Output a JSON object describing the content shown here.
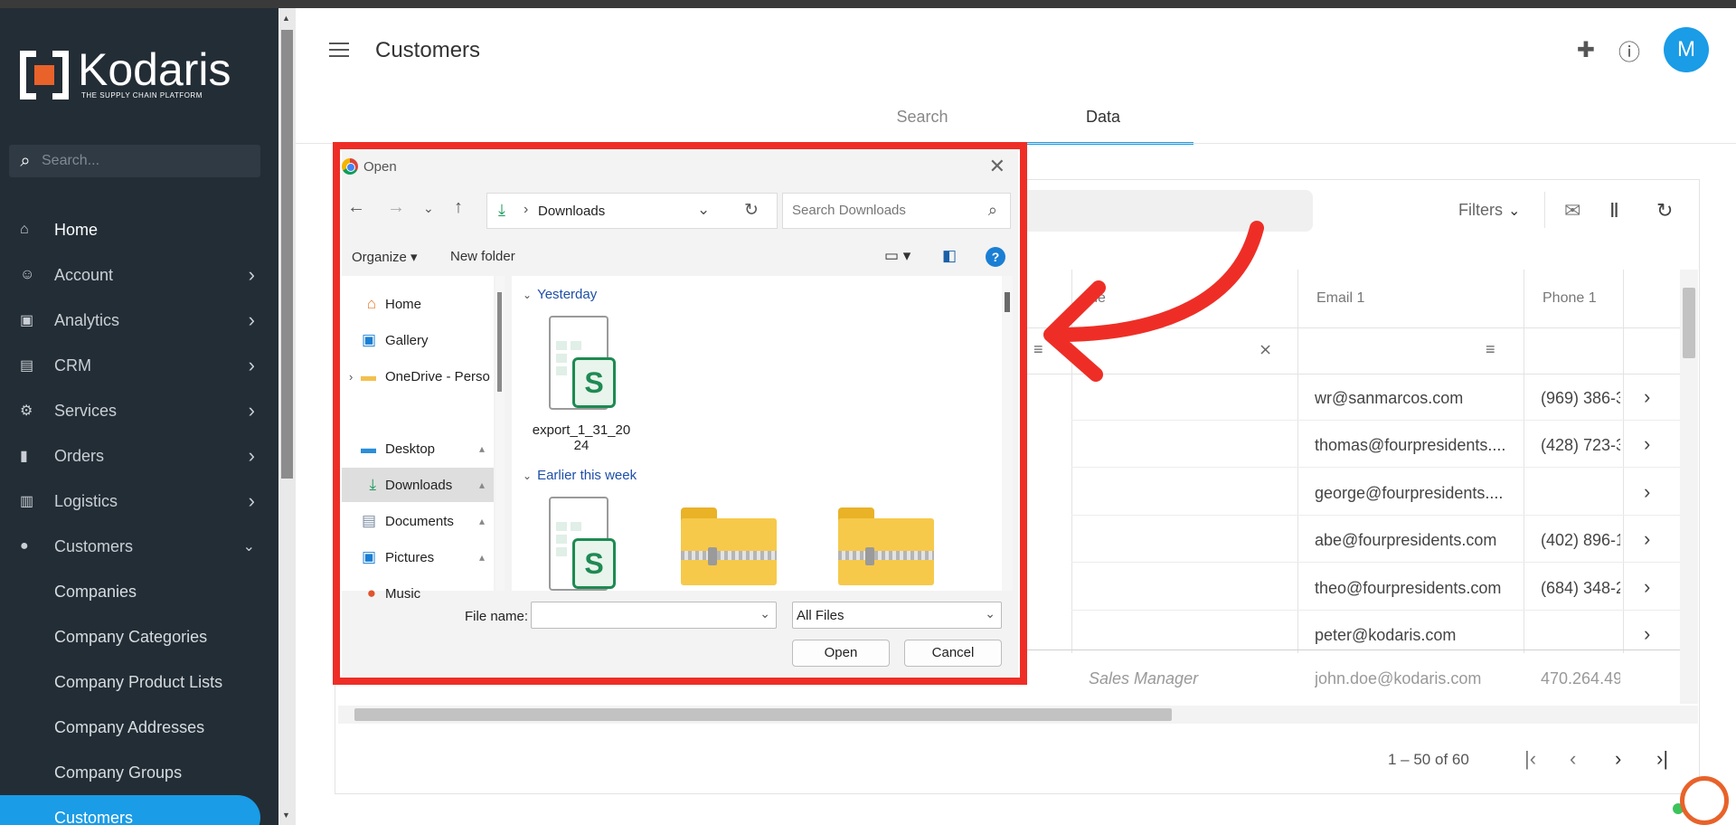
{
  "sidebar": {
    "brand": {
      "name": "Kodaris",
      "tagline": "THE SUPPLY CHAIN PLATFORM"
    },
    "search_placeholder": "Search...",
    "items": [
      {
        "label": "Home",
        "icon": "home-icon"
      },
      {
        "label": "Account",
        "icon": "account-icon"
      },
      {
        "label": "Analytics",
        "icon": "analytics-icon"
      },
      {
        "label": "CRM",
        "icon": "crm-icon"
      },
      {
        "label": "Services",
        "icon": "services-icon"
      },
      {
        "label": "Orders",
        "icon": "truck-icon"
      },
      {
        "label": "Logistics",
        "icon": "logistics-icon"
      },
      {
        "label": "Customers",
        "icon": "people-icon"
      }
    ],
    "sub_items": [
      "Companies",
      "Company Categories",
      "Company Product Lists",
      "Company Addresses",
      "Company Groups",
      "Customers"
    ]
  },
  "header": {
    "title": "Customers",
    "avatar_initial": "M",
    "tabs": [
      "Search",
      "Data"
    ]
  },
  "table": {
    "filters_label": "Filters",
    "columns": [
      "tle",
      "Email 1",
      "Phone 1"
    ],
    "rows": [
      {
        "email": "wr@sanmarcos.com",
        "phone": "(969) 386-3"
      },
      {
        "email": "thomas@fourpresidents....",
        "phone": "(428) 723-3"
      },
      {
        "email": "george@fourpresidents....",
        "phone": ""
      },
      {
        "email": "abe@fourpresidents.com",
        "phone": "(402) 896-1"
      },
      {
        "email": "theo@fourpresidents.com",
        "phone": "(684) 348-2"
      },
      {
        "email": "peter@kodaris.com",
        "phone": ""
      }
    ],
    "last_row": {
      "title": "Sales Manager",
      "email": "john.doe@kodaris.com",
      "phone": "470.264.49"
    },
    "pagination": "1 – 50 of 60"
  },
  "dialog": {
    "title": "Open",
    "address_path": "Downloads",
    "search_placeholder": "Search Downloads",
    "organize_label": "Organize",
    "new_folder_label": "New folder",
    "nav_items": [
      {
        "label": "Home",
        "icon": "home-icon"
      },
      {
        "label": "Gallery",
        "icon": "gallery-icon"
      },
      {
        "label": "OneDrive - Perso",
        "icon": "folder-icon"
      },
      {
        "label": "Desktop",
        "icon": "desktop-icon"
      },
      {
        "label": "Downloads",
        "icon": "download-icon"
      },
      {
        "label": "Documents",
        "icon": "documents-icon"
      },
      {
        "label": "Pictures",
        "icon": "pictures-icon"
      },
      {
        "label": "Music",
        "icon": "music-icon"
      }
    ],
    "groups": [
      "Yesterday",
      "Earlier this week"
    ],
    "files": [
      {
        "name": "export_1_31_2024",
        "type": "spreadsheet"
      }
    ],
    "file_name_label": "File name:",
    "file_name_value": "",
    "file_type": "All Files",
    "open_label": "Open",
    "cancel_label": "Cancel"
  },
  "colors": {
    "sidebar_bg": "#232d36",
    "accent": "#1a9ce6",
    "highlight_red": "#ee2e26",
    "brand_orange": "#e8622a"
  }
}
